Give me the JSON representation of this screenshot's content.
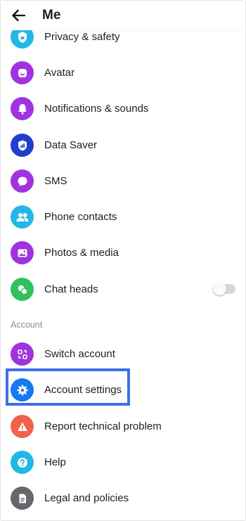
{
  "header": {
    "title": "Me",
    "back_icon": "arrow-left-icon"
  },
  "menu": {
    "privacy": {
      "label": "Privacy & safety",
      "icon": "shield-lock-icon",
      "color": "#21b8e5"
    },
    "avatar": {
      "label": "Avatar",
      "icon": "avatar-face-icon",
      "color": "#a033e0"
    },
    "notifications": {
      "label": "Notifications & sounds",
      "icon": "bell-icon",
      "color": "#a033e0"
    },
    "data_saver": {
      "label": "Data Saver",
      "icon": "data-shield-icon",
      "color": "#1f3ecf"
    },
    "sms": {
      "label": "SMS",
      "icon": "chat-bubble-icon",
      "color": "#a033e0"
    },
    "phone_contacts": {
      "label": "Phone contacts",
      "icon": "people-icon",
      "color": "#21b8e5"
    },
    "photos_media": {
      "label": "Photos & media",
      "icon": "image-icon",
      "color": "#a033e0"
    },
    "chat_heads": {
      "label": "Chat heads",
      "icon": "chat-heads-icon",
      "color": "#2fc25a",
      "toggle_on": false
    }
  },
  "account_section": {
    "label": "Account",
    "switch_account": {
      "label": "Switch account",
      "icon": "switch-account-icon",
      "color": "#a033e0"
    },
    "account_settings": {
      "label": "Account settings",
      "icon": "gear-icon",
      "color": "#1877f2",
      "highlighted": true
    },
    "report_problem": {
      "label": "Report technical problem",
      "icon": "warning-icon",
      "color": "#f0614e"
    },
    "help": {
      "label": "Help",
      "icon": "question-icon",
      "color": "#21b8e5"
    },
    "legal": {
      "label": "Legal and policies",
      "icon": "document-icon",
      "color": "#65676b"
    }
  },
  "colors": {
    "highlight_border": "#3e6ee8",
    "toggle_off": "#d5d7db"
  }
}
